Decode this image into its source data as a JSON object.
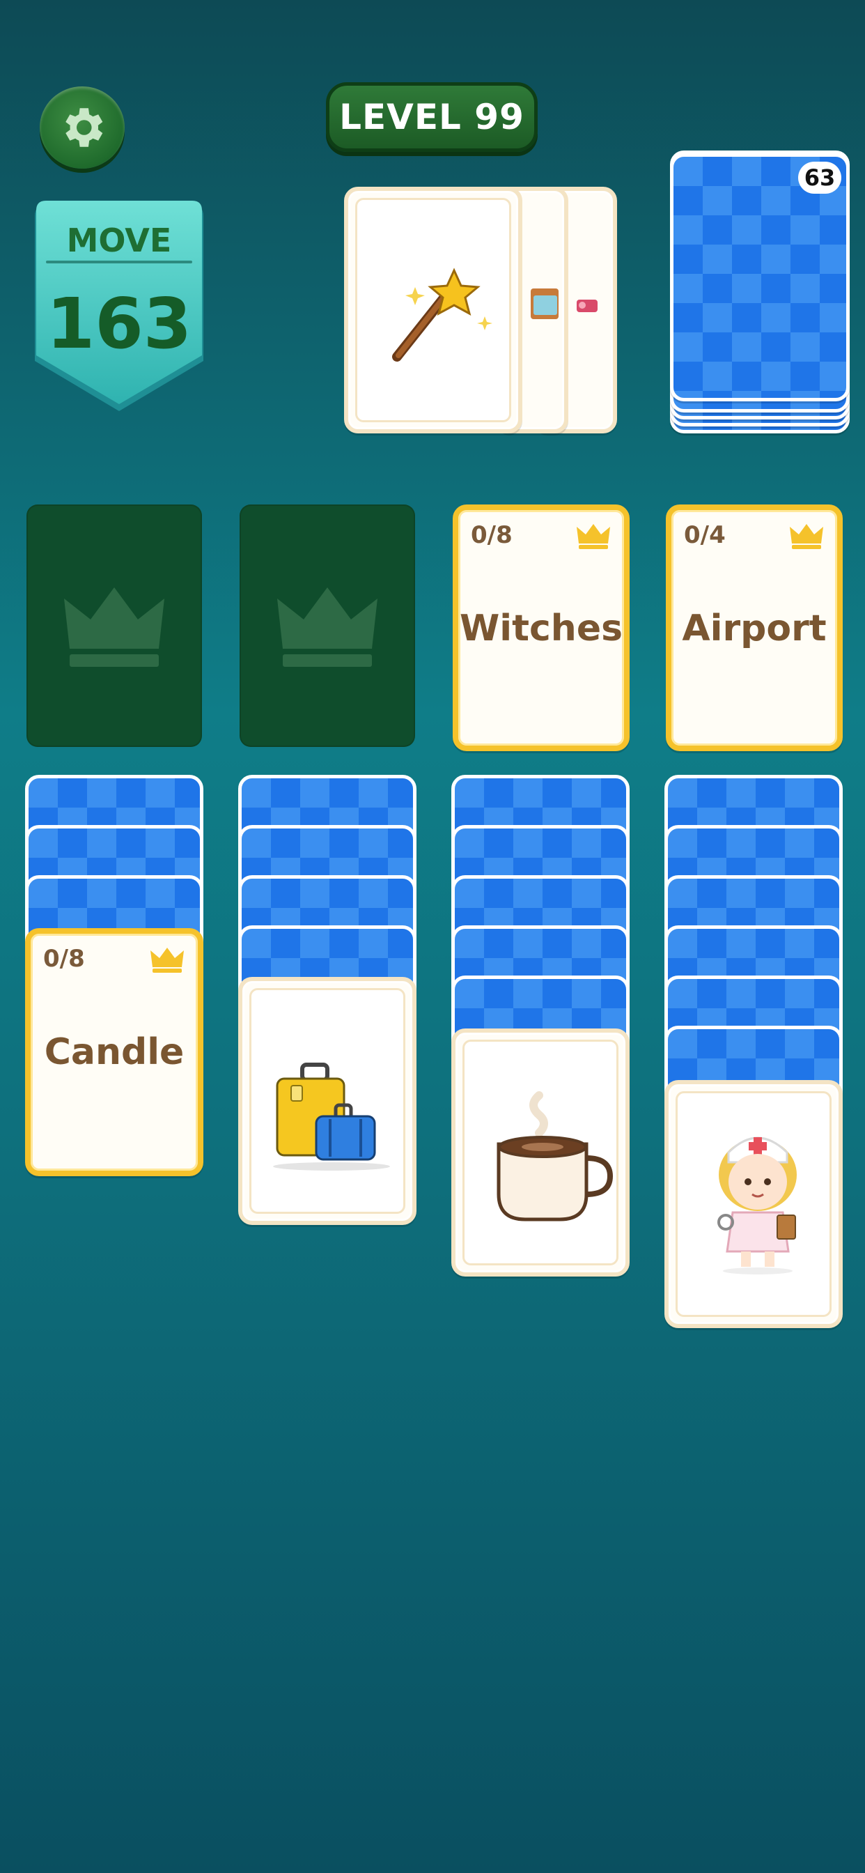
{
  "header": {
    "level_label": "LEVEL 99"
  },
  "moves": {
    "label": "MOVE",
    "count": "163"
  },
  "deck": {
    "remaining": "63"
  },
  "foundations": [
    {
      "slot": "empty"
    },
    {
      "slot": "empty"
    },
    {
      "slot": "category",
      "name": "Witches",
      "progress": "0/8"
    },
    {
      "slot": "category",
      "name": "Airport",
      "progress": "0/4"
    }
  ],
  "tableau": {
    "col1": {
      "category_name": "Candle",
      "progress": "0/8"
    }
  },
  "icons": {
    "settings": "gear-icon",
    "crown": "crown-icon",
    "wand": "magic-wand-icon",
    "bed": "bed-icon",
    "luggage": "luggage-icon",
    "coffee": "coffee-cup-icon",
    "nurse": "nurse-icon"
  },
  "colors": {
    "accent_gold": "#f5c22b",
    "card_back_blue": "#3b8ff0",
    "dark_green": "#1c5b25"
  }
}
